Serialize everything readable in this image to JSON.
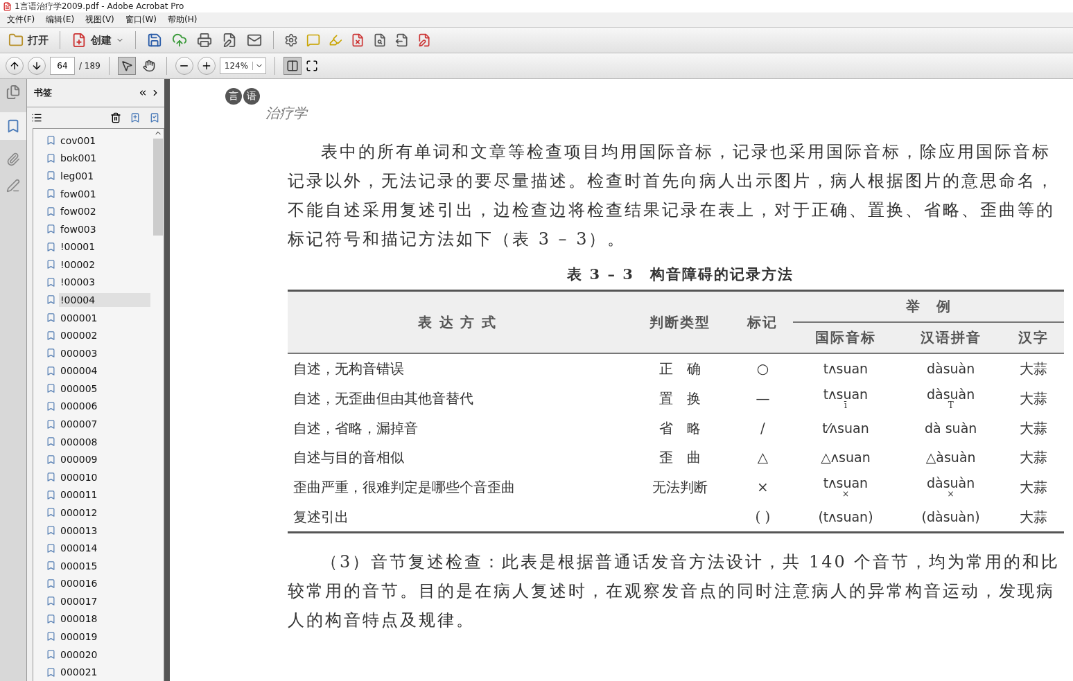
{
  "window": {
    "title": "1言语治疗学2009.pdf - Adobe Acrobat Pro"
  },
  "menu": [
    "文件(F)",
    "编辑(E)",
    "视图(V)",
    "窗口(W)",
    "帮助(H)"
  ],
  "toolbar": {
    "open": "打开",
    "create": "创建"
  },
  "nav": {
    "page": "64",
    "total": "/ 189",
    "zoom": "124%",
    "select_tool_selected": true
  },
  "panel": {
    "title": "书签",
    "bookmarks": [
      {
        "label": "cov001",
        "selected": false
      },
      {
        "label": "bok001",
        "selected": false
      },
      {
        "label": "leg001",
        "selected": false
      },
      {
        "label": "fow001",
        "selected": false
      },
      {
        "label": "fow002",
        "selected": false
      },
      {
        "label": "fow003",
        "selected": false
      },
      {
        "label": "!00001",
        "selected": false
      },
      {
        "label": "!00002",
        "selected": false
      },
      {
        "label": "!00003",
        "selected": false
      },
      {
        "label": "!00004",
        "selected": true
      },
      {
        "label": "000001",
        "selected": false
      },
      {
        "label": "000002",
        "selected": false
      },
      {
        "label": "000003",
        "selected": false
      },
      {
        "label": "000004",
        "selected": false
      },
      {
        "label": "000005",
        "selected": false
      },
      {
        "label": "000006",
        "selected": false
      },
      {
        "label": "000007",
        "selected": false
      },
      {
        "label": "000008",
        "selected": false
      },
      {
        "label": "000009",
        "selected": false
      },
      {
        "label": "000010",
        "selected": false
      },
      {
        "label": "000011",
        "selected": false
      },
      {
        "label": "000012",
        "selected": false
      },
      {
        "label": "000013",
        "selected": false
      },
      {
        "label": "000014",
        "selected": false
      },
      {
        "label": "000015",
        "selected": false
      },
      {
        "label": "000016",
        "selected": false
      },
      {
        "label": "000017",
        "selected": false
      },
      {
        "label": "000018",
        "selected": false
      },
      {
        "label": "000019",
        "selected": false
      },
      {
        "label": "000020",
        "selected": false
      },
      {
        "label": "000021",
        "selected": false
      }
    ]
  },
  "document": {
    "header_badge": [
      "言",
      "语"
    ],
    "header_title": "治疗学",
    "paragraph_1": "表中的所有单词和文章等检查项目均用国际音标，记录也采用国际音标，除应用国际音标记录以外，无法记录的要尽量描述。检查时首先向病人出示图片，病人根据图片的意思命名，不能自述采用复述引出，边检查边将检查结果记录在表上，对于正确、置换、省略、歪曲等的标记符号和描记方法如下（表 3 – 3）。",
    "table_title": "表 3 – 3　构音障碍的记录方法",
    "table": {
      "columns": [
        "表 达 方 式",
        "判断类型",
        "标记"
      ],
      "group_header": "举　例",
      "subcolumns": [
        "国际音标",
        "汉语拼音",
        "汉字"
      ],
      "rows": [
        {
          "expression": "自述，无构音错误",
          "judgement": "正　确",
          "mark": "○",
          "ipa": "tʌsuan",
          "pinyin": "dàsuàn",
          "hanzi": "大蒜"
        },
        {
          "expression": "自述，无歪曲但由其他音替代",
          "judgement": "置　换",
          "mark": "—",
          "ipa": "tʌsuan",
          "ipa_sub": "ī",
          "pinyin": "dàsuàn",
          "pinyin_sub": "T",
          "hanzi": "大蒜"
        },
        {
          "expression": "自述，省略，漏掉音",
          "judgement": "省　略",
          "mark": "/",
          "ipa": "t⁄ʌsuan",
          "pinyin": "dà suàn",
          "hanzi": "大蒜"
        },
        {
          "expression": "自述与目的音相似",
          "judgement": "歪　曲",
          "mark": "△",
          "ipa": "△ʌsuan",
          "pinyin": "△àsuàn",
          "hanzi": "大蒜"
        },
        {
          "expression": "歪曲严重，很难判定是哪些个音歪曲",
          "judgement": "无法判断",
          "mark": "×",
          "ipa": "tʌsuan",
          "ipa_sub": "×",
          "pinyin": "dàsuàn",
          "pinyin_sub": "×",
          "hanzi": "大蒜"
        },
        {
          "expression": "复述引出",
          "judgement": "",
          "mark": "( )",
          "ipa": "(tʌsuan)",
          "pinyin": "(dàsuàn)",
          "hanzi": "大蒜"
        }
      ]
    },
    "paragraph_2": "（3）音节复述检查：此表是根据普通话发音方法设计，共 140 个音节，均为常用的和比较常用的音节。目的是在病人复述时，在观察发音点的同时注意病人的异常构音运动，发现病人的构音特点及规律。"
  }
}
